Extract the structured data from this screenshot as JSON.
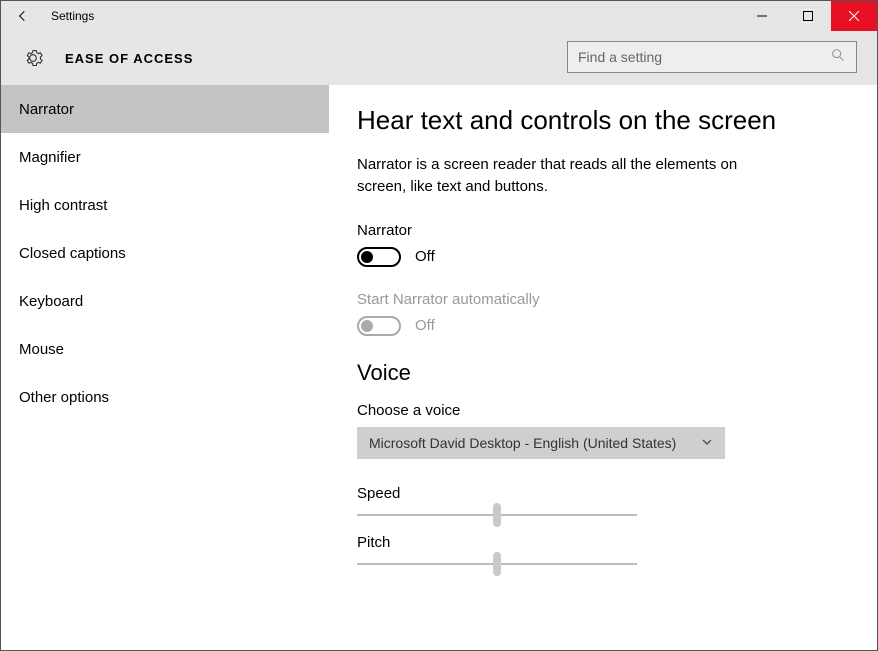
{
  "window": {
    "title": "Settings"
  },
  "category": "EASE OF ACCESS",
  "search": {
    "placeholder": "Find a setting"
  },
  "sidebar": {
    "items": [
      {
        "label": "Narrator",
        "active": true
      },
      {
        "label": "Magnifier",
        "active": false
      },
      {
        "label": "High contrast",
        "active": false
      },
      {
        "label": "Closed captions",
        "active": false
      },
      {
        "label": "Keyboard",
        "active": false
      },
      {
        "label": "Mouse",
        "active": false
      },
      {
        "label": "Other options",
        "active": false
      }
    ]
  },
  "main": {
    "heading": "Hear text and controls on the screen",
    "description": "Narrator is a screen reader that reads all the elements on screen, like text and buttons.",
    "narrator_toggle": {
      "label": "Narrator",
      "state": "Off",
      "enabled": true,
      "on": false
    },
    "auto_toggle": {
      "label": "Start Narrator automatically",
      "state": "Off",
      "enabled": false,
      "on": false
    },
    "voice_heading": "Voice",
    "choose_voice_label": "Choose a voice",
    "voice_dropdown": {
      "selected": "Microsoft David Desktop - English (United States)"
    },
    "speed": {
      "label": "Speed",
      "value": 50
    },
    "pitch": {
      "label": "Pitch",
      "value": 50
    }
  }
}
